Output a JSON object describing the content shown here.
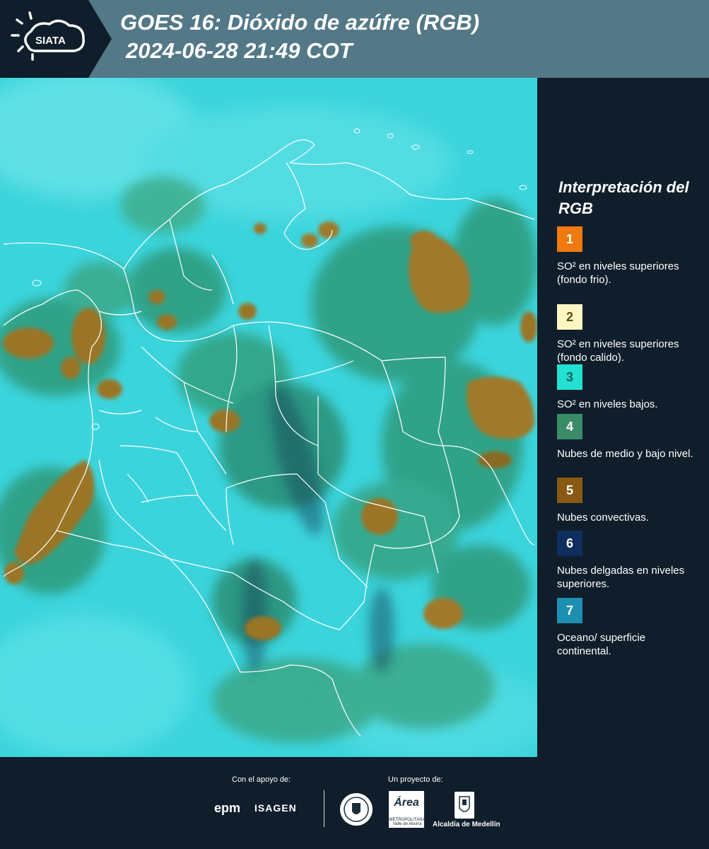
{
  "header": {
    "logo_text": "SIATA",
    "title_line1": "GOES 16: Dióxido de azúfre (RGB)",
    "title_line2": "2024-06-28 21:49 COT"
  },
  "map": {
    "background_color": "#3bd4dc",
    "cloud_green_color": "#2f9a7a",
    "convective_color": "#a0792a",
    "border_color": "#ffffff"
  },
  "legend": {
    "title": "Interpretación del RGB",
    "items": [
      {
        "number": "1",
        "color": "#f07a10",
        "number_color": "#ffffff",
        "text": "SO² en niveles superiores (fondo frio)."
      },
      {
        "number": "2",
        "color": "#fff6c4",
        "number_color": "#5a4a10",
        "text": "SO² en niveles superiores (fondo calido)."
      },
      {
        "number": "3",
        "color": "#22e0d2",
        "number_color": "#0d5e58",
        "text": "SO² en niveles bajos."
      },
      {
        "number": "4",
        "color": "#3a8c68",
        "number_color": "#ffffff",
        "text": "Nubes de medio y bajo nivel."
      },
      {
        "number": "5",
        "color": "#8a5a14",
        "number_color": "#ffffff",
        "text": "Nubes convectivas."
      },
      {
        "number": "6",
        "color": "#0f2e5e",
        "number_color": "#ffffff",
        "text": "Nubes delgadas en niveles superiores."
      },
      {
        "number": "7",
        "color": "#1d8fb2",
        "number_color": "#ffffff",
        "text": "Oceano/ superficie continental."
      }
    ]
  },
  "footer": {
    "support_label": "Con el apoyo de:",
    "project_label": "Un proyecto de:",
    "epm": "epm",
    "isagen": "ISAGEN",
    "area_logo": "Área",
    "area_sub": "METROPOLITANA Valle de Aburrá",
    "alcaldia": "Alcaldía de Medellín"
  }
}
